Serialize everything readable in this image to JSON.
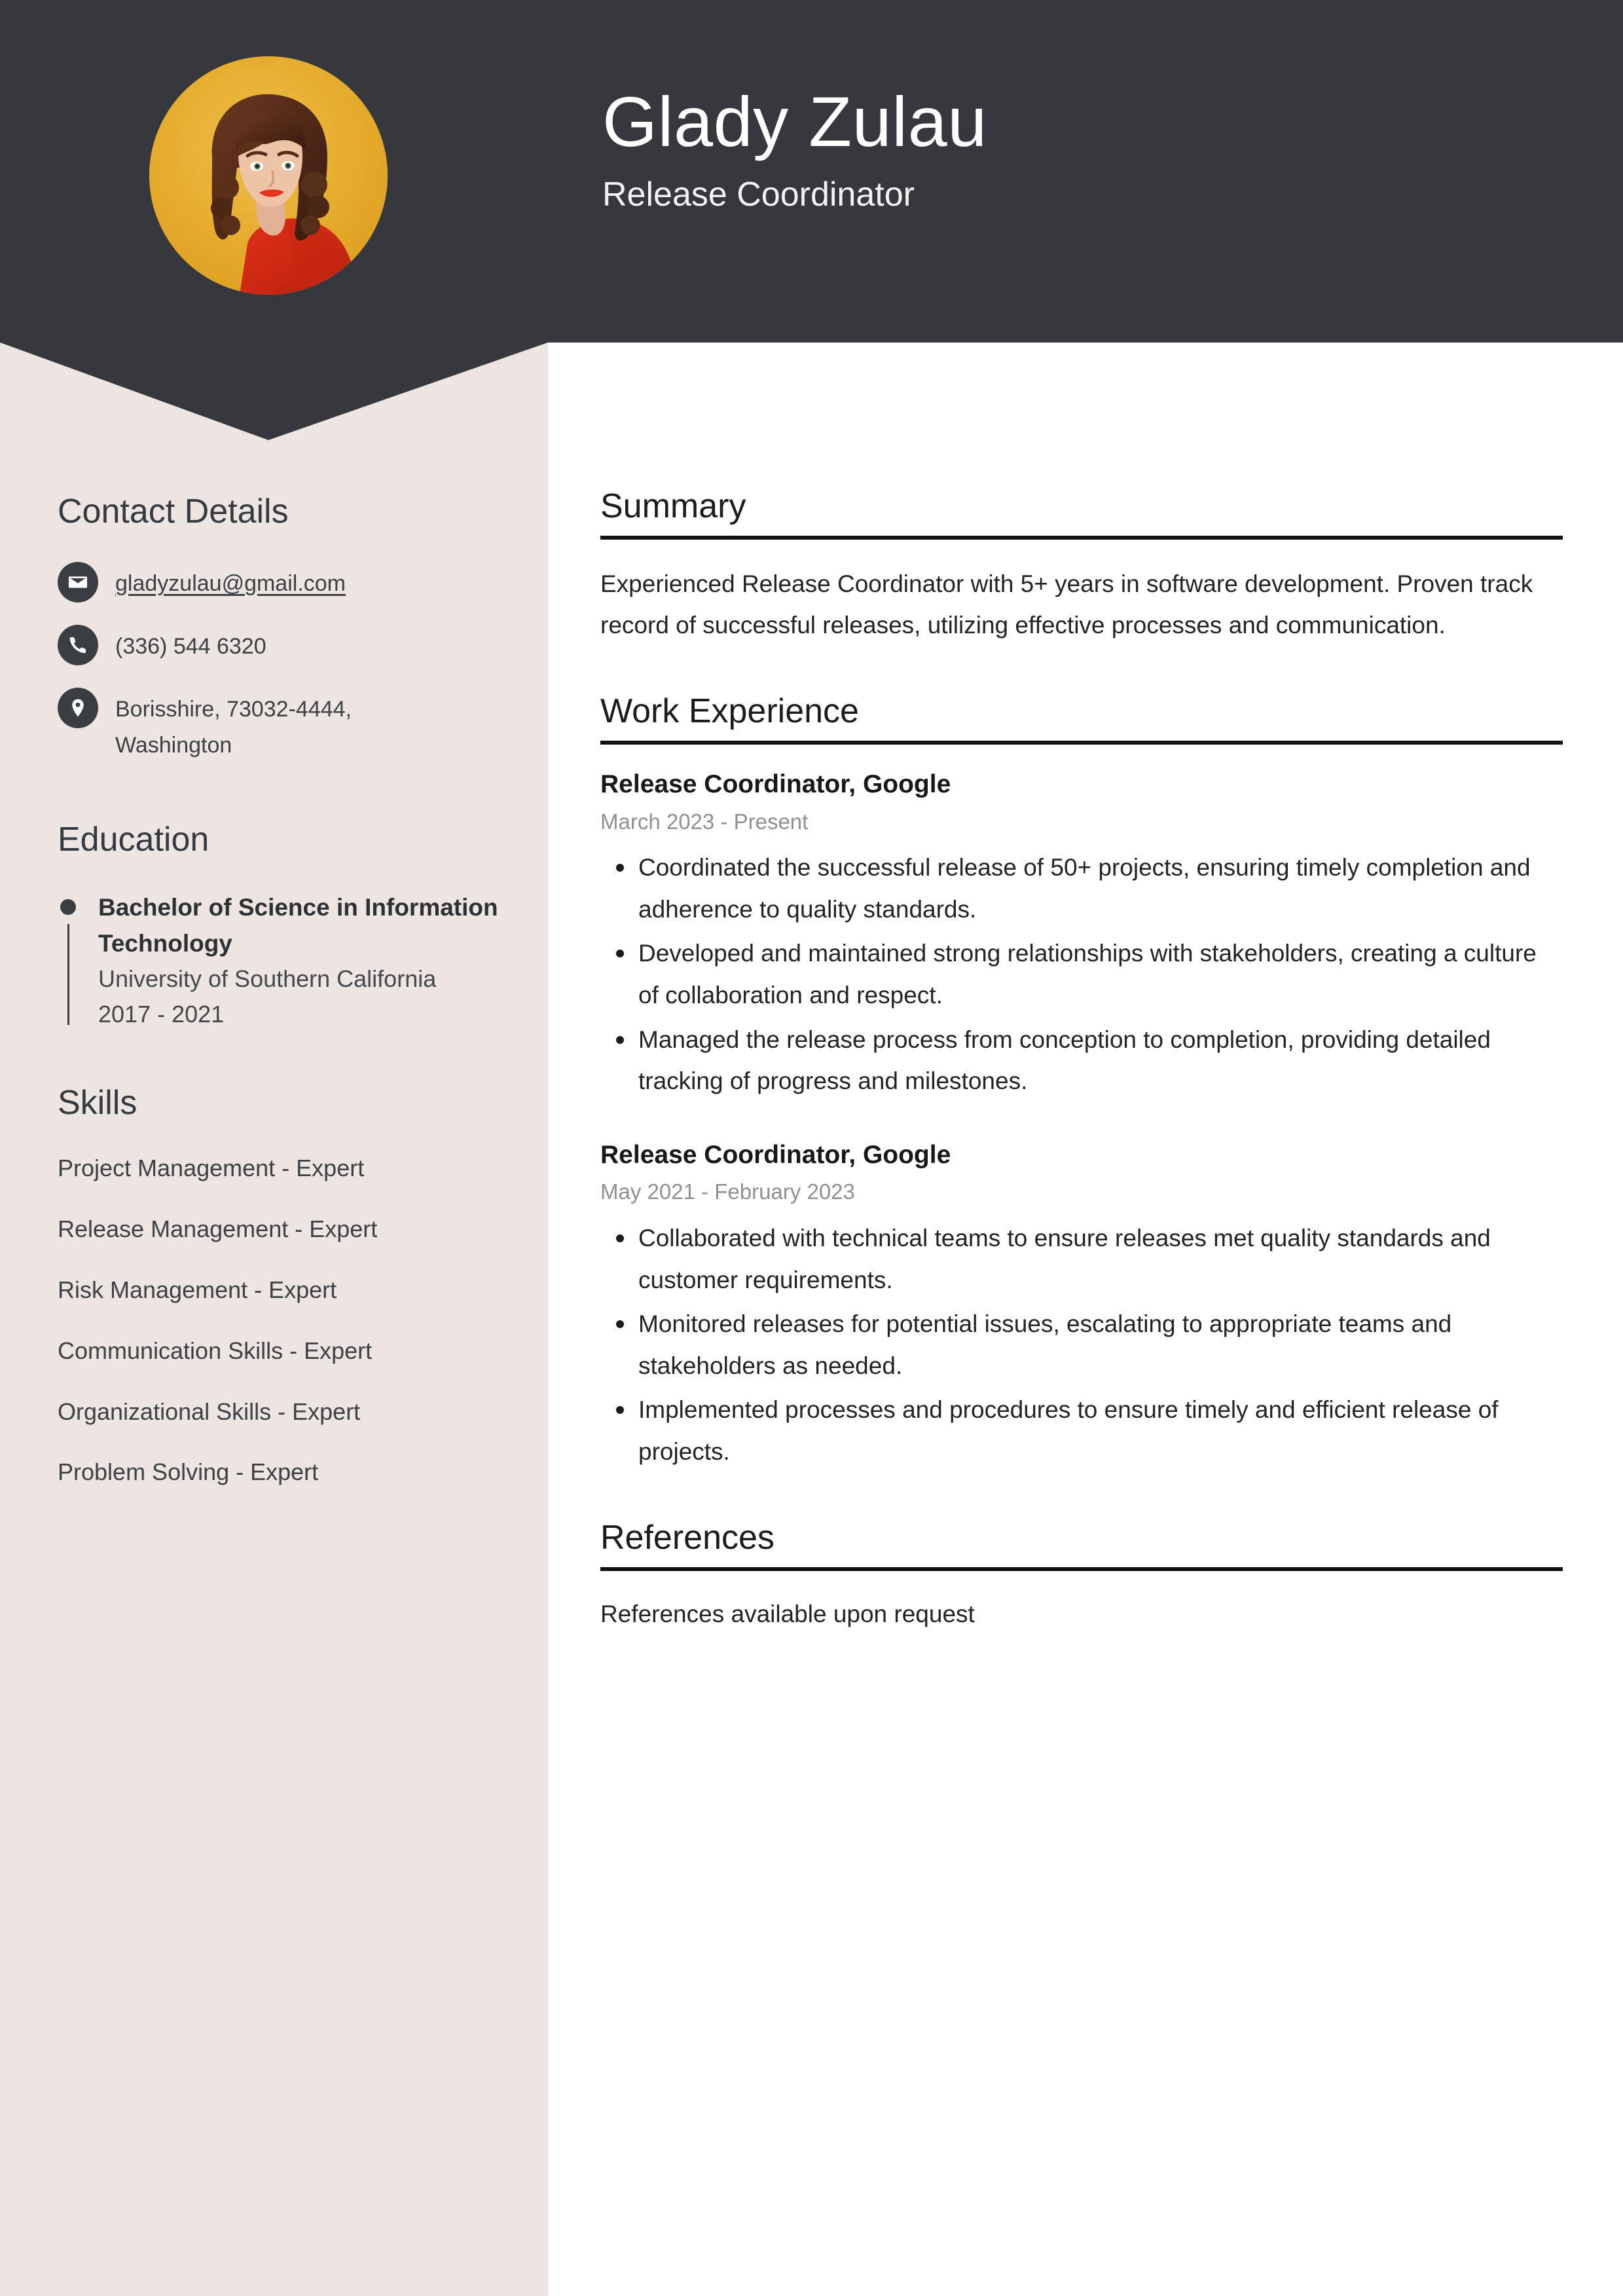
{
  "header": {
    "name": "Glady Zulau",
    "role": "Release Coordinator",
    "avatar_alt": "profile-photo"
  },
  "colors": {
    "header_dark": "#36383d",
    "sidebar_cream": "#ede5e1",
    "icon_circle": "#3a3d42",
    "accent_photo_bg": "#e3a82c",
    "date_gray": "#8f9094"
  },
  "sidebar": {
    "contact": {
      "heading": "Contact Details",
      "items": [
        {
          "icon": "envelope-icon",
          "value": "gladyzulau@gmail.com",
          "link": true
        },
        {
          "icon": "phone-icon",
          "value": "(336) 544 6320",
          "link": false
        },
        {
          "icon": "map-pin-icon",
          "value": "Borisshire, 73032-4444, Washington",
          "link": false
        }
      ]
    },
    "education": {
      "heading": "Education",
      "items": [
        {
          "degree": "Bachelor of Science in Information Technology",
          "school": "University of Southern California",
          "dates": "2017 - 2021"
        }
      ]
    },
    "skills": {
      "heading": "Skills",
      "items": [
        "Project Management - Expert",
        "Release Management - Expert",
        "Risk Management - Expert",
        "Communication Skills - Expert",
        "Organizational Skills - Expert",
        "Problem Solving - Expert"
      ]
    }
  },
  "main": {
    "summary": {
      "heading": "Summary",
      "text": "Experienced Release Coordinator with 5+ years in software development. Proven track record of successful releases, utilizing effective processes and communication."
    },
    "work_experience": {
      "heading": "Work Experience",
      "jobs": [
        {
          "title": "Release Coordinator, Google",
          "date": "March 2023 - Present",
          "bullets": [
            "Coordinated the successful release of 50+ projects, ensuring timely completion and adherence to quality standards.",
            "Developed and maintained strong relationships with stakeholders, creating a culture of collaboration and respect.",
            "Managed the release process from conception to completion, providing detailed tracking of progress and milestones."
          ]
        },
        {
          "title": "Release Coordinator, Google",
          "date": "May 2021 - February 2023",
          "bullets": [
            "Collaborated with technical teams to ensure releases met quality standards and customer requirements.",
            "Monitored releases for potential issues, escalating to appropriate teams and stakeholders as needed.",
            "Implemented processes and procedures to ensure timely and efficient release of projects."
          ]
        }
      ]
    },
    "references": {
      "heading": "References",
      "text": "References available upon request"
    }
  }
}
